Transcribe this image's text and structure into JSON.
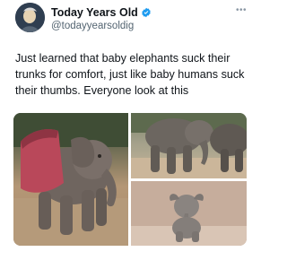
{
  "author": {
    "name": "Today Years Old",
    "handle": "@todayyearsoldig",
    "avatar_icon": "avatar-photo"
  },
  "icons": {
    "verified": "verified-badge-icon",
    "more": "more-options-icon"
  },
  "colors": {
    "verified": "#1d9bf0",
    "text": "#0f1419",
    "secondary_text": "#536471"
  },
  "tweet": {
    "text": "Just learned that baby elephants suck their trunks for comfort, just like baby humans suck their thumbs. Everyone look at this"
  },
  "media": {
    "count": 3,
    "items": [
      "baby elephant with red blanket",
      "elephants walking",
      "baby elephant sitting sucking trunk"
    ]
  }
}
